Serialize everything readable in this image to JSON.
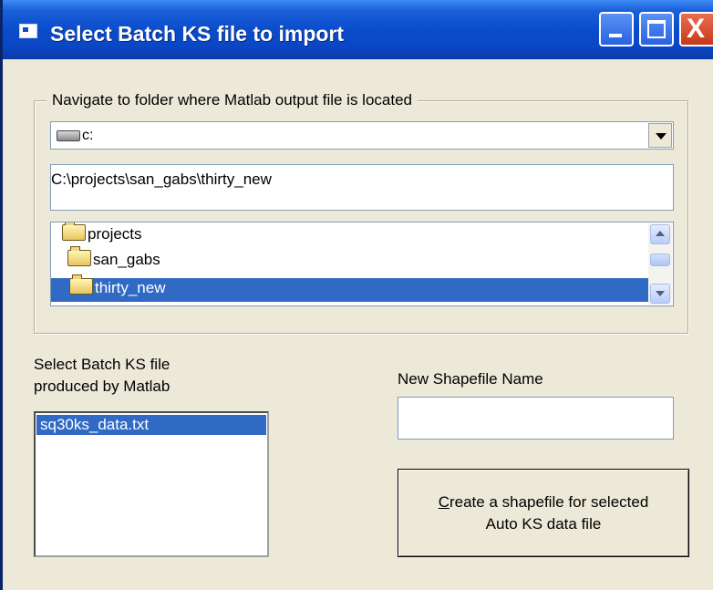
{
  "window": {
    "title": "Select Batch KS file to import",
    "close_glyph": "X"
  },
  "navigate": {
    "legend": "Navigate to folder where Matlab output file is located",
    "drive": "c:",
    "path": "C:\\projects\\san_gabs\\thirty_new",
    "folders": [
      {
        "label": "projects",
        "icon": "folder-open-icon"
      },
      {
        "label": "san_gabs",
        "icon": "folder-open-icon"
      },
      {
        "label": "thirty_new",
        "icon": "folder-open-icon",
        "selected": true
      }
    ]
  },
  "batch": {
    "label_line1": "Select Batch KS file",
    "label_line2": "produced by Matlab",
    "files": [
      "sq30ks_data.txt"
    ]
  },
  "shapefile": {
    "label": "New Shapefile Name",
    "value": ""
  },
  "create_button": {
    "line1": "Create a shapefile for selected",
    "line2": "Auto KS data file"
  },
  "colors": {
    "titlebar": "#0b4ccc",
    "window_bg": "#ece9d8",
    "selection": "#316ac5"
  }
}
